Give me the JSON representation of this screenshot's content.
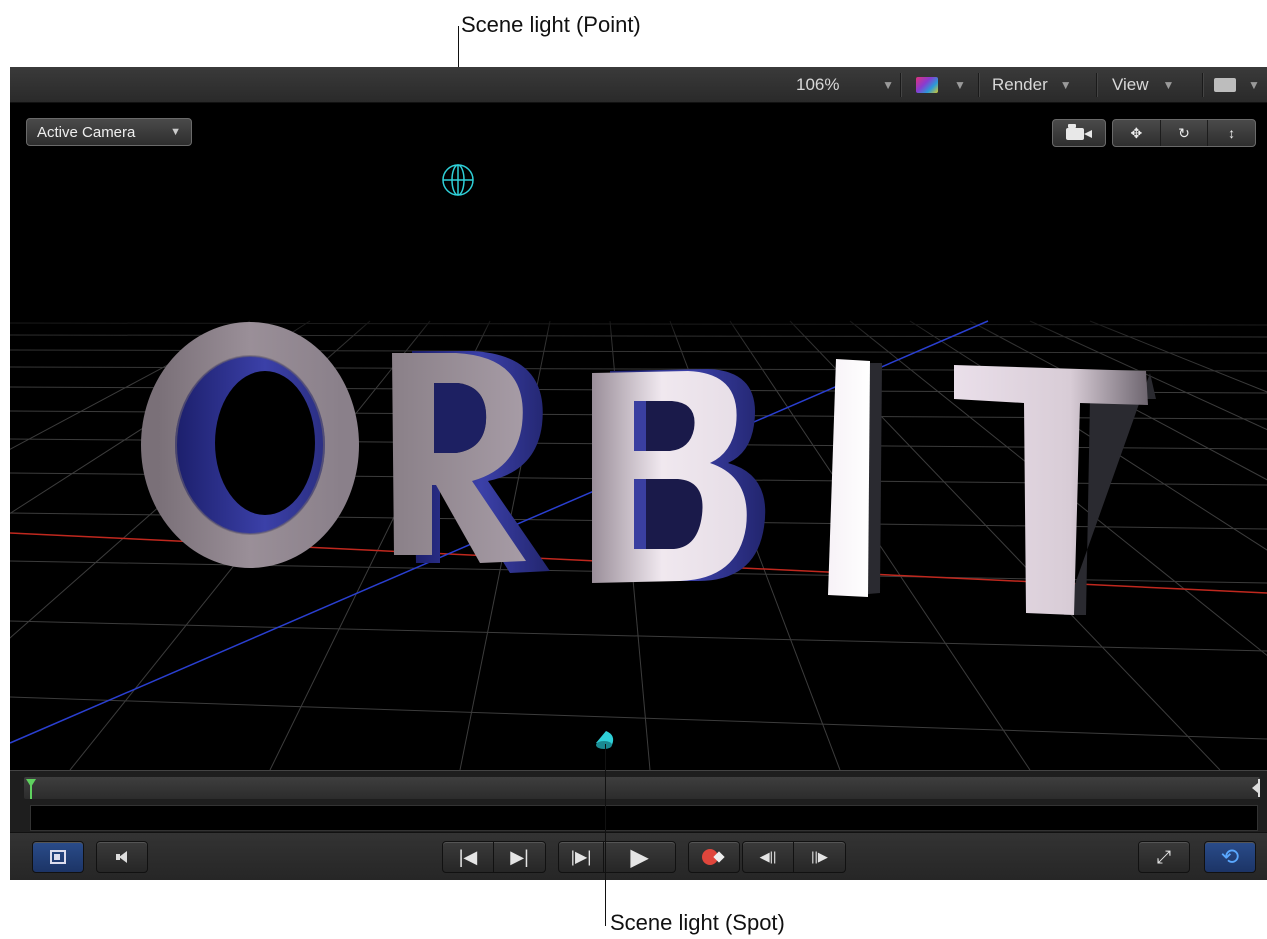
{
  "callouts": {
    "point_light": "Scene light (Point)",
    "spot_light": "Scene light (Spot)"
  },
  "toolbar": {
    "zoom_value": "106%",
    "render_label": "Render",
    "view_label": "View"
  },
  "viewer": {
    "camera_menu_label": "Active Camera",
    "scene_text": "ORBIT"
  },
  "icons": {
    "zoom_caret": "chevron-down-icon",
    "channels": "color-channels-icon",
    "camera": "camera-icon",
    "pan": "pan-icon",
    "orbit": "orbit-icon",
    "dolly": "dolly-icon",
    "point_light": "point-light-icon",
    "spot_light": "spot-light-icon",
    "playhead": "playhead-icon",
    "out_point": "out-point-icon",
    "show_timing": "timing-display-icon",
    "audio": "speaker-icon",
    "go_start": "go-to-start-icon",
    "go_end": "go-to-end-icon",
    "play_from_start": "play-from-start-icon",
    "play": "play-icon",
    "record": "record-icon",
    "prev_frame": "previous-frame-icon",
    "next_frame": "next-frame-icon",
    "fullscreen": "fullscreen-icon",
    "loop": "loop-icon"
  },
  "colors": {
    "light_overlay": "#2fd0d8",
    "x_axis": "#c0281e",
    "z_axis": "#2a3fd0",
    "extrude_blue": "#2a2e8c",
    "active_button": "#2a4c8a"
  }
}
